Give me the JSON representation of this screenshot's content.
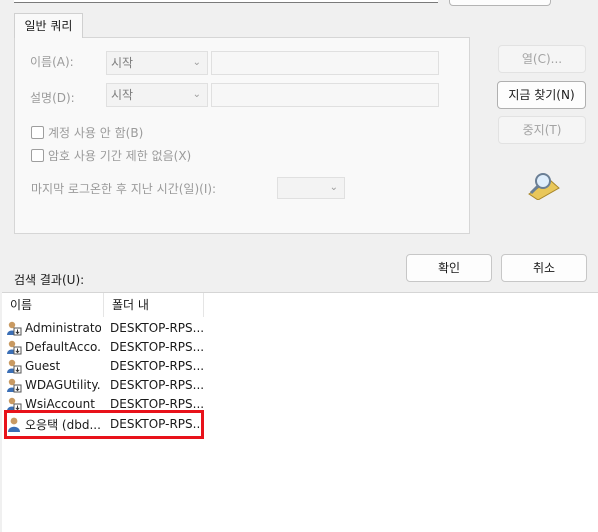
{
  "tabs": {
    "general_query": "일반 쿼리"
  },
  "query": {
    "name_label": "이름(A):",
    "name_mode": "시작",
    "name_value": "",
    "desc_label": "설명(D):",
    "desc_mode": "시작",
    "desc_value": "",
    "disabled_accounts_label": "계정 사용 안 함(B)",
    "no_expire_label": "암호 사용 기간 제한 없음(X)",
    "last_logon_label": "마지막 로그온한 후 지난 시간(일)(I):",
    "last_logon_value": ""
  },
  "buttons": {
    "columns": "열(C)...",
    "find_now": "지금 찾기(N)",
    "stop": "중지(T)",
    "ok": "확인",
    "cancel": "취소"
  },
  "results": {
    "label": "검색 결과(U):",
    "columns": [
      "이름",
      "폴더 내"
    ],
    "rows": [
      {
        "name": "Administrator",
        "folder": "DESKTOP-RPS..."
      },
      {
        "name": "DefaultAcco...",
        "folder": "DESKTOP-RPS..."
      },
      {
        "name": "Guest",
        "folder": "DESKTOP-RPS..."
      },
      {
        "name": "WDAGUtility...",
        "folder": "DESKTOP-RPS..."
      },
      {
        "name": "WsiAccount",
        "folder": "DESKTOP-RPS..."
      },
      {
        "name": "오응택 (dbd...",
        "folder": "DESKTOP-RPS..."
      }
    ]
  },
  "colors": {
    "highlight": "#e8121a",
    "user_icon": "#3b6fb6"
  }
}
